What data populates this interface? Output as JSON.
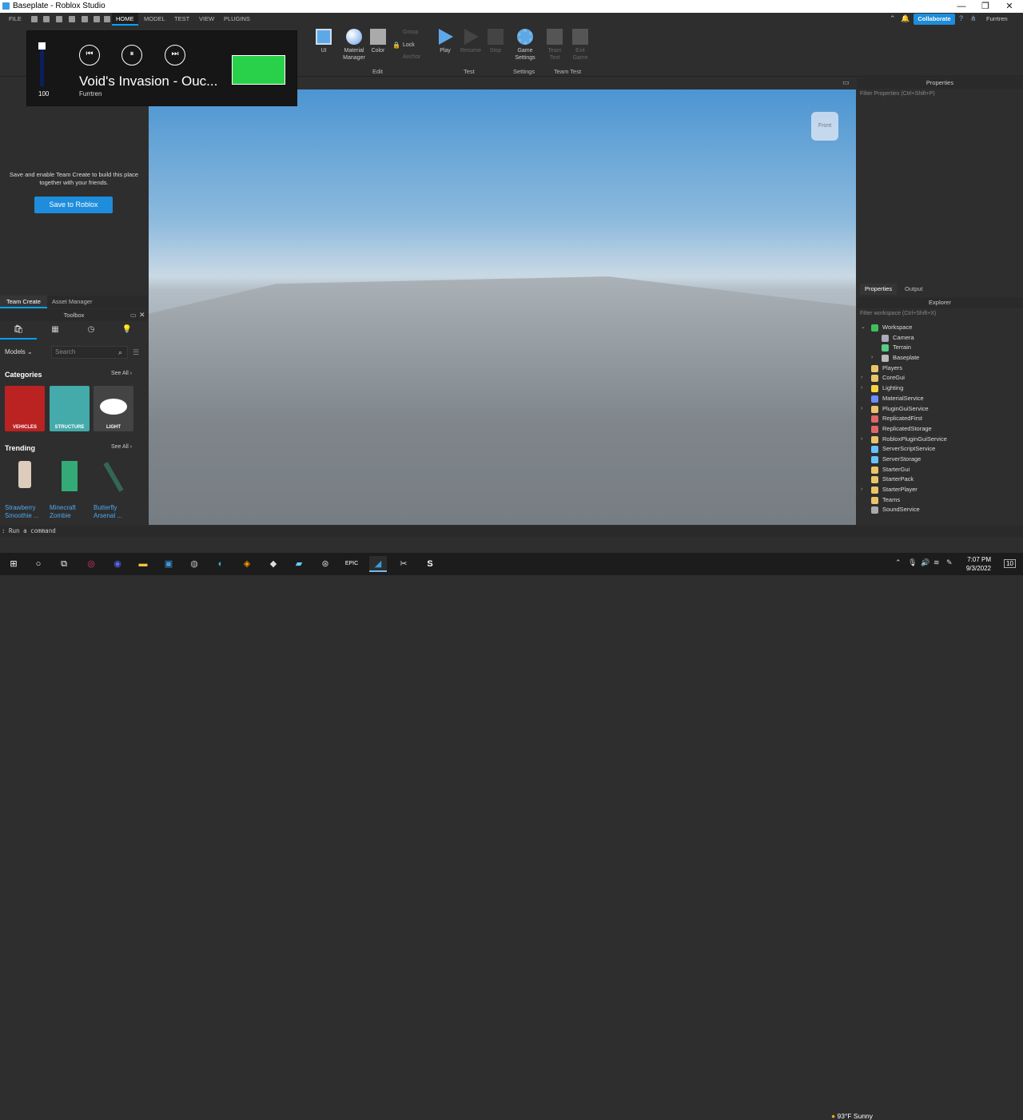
{
  "window": {
    "title": "Baseplate - Roblox Studio",
    "min": "—",
    "max": "❐",
    "close": "✕"
  },
  "menu": {
    "file": "FILE",
    "tabs": [
      "HOME",
      "MODEL",
      "TEST",
      "VIEW",
      "PLUGINS"
    ],
    "collaborate": "Collaborate",
    "user": "Furrtren"
  },
  "ribbon": {
    "ui": "UI",
    "material_manager": "Material Manager",
    "color": "Color",
    "group": "Group",
    "lock": "Lock",
    "anchor": "Anchor",
    "play": "Play",
    "resume": "Resume",
    "stop": "Stop",
    "game_settings": "Game Settings",
    "team_test": "Team Test",
    "exit_game": "Exit Game",
    "groups": {
      "edit": "Edit",
      "test": "Test",
      "settings": "Settings",
      "team_test": "Team Test"
    }
  },
  "media": {
    "song": "Void's Invasion - Ouc...",
    "artist": "Furrtren",
    "volume": "100",
    "prev": "⏮",
    "pause": "⏸",
    "next": "⏭"
  },
  "team_create": {
    "message": "Save and enable Team Create to build this place together with your friends.",
    "save_button": "Save to Roblox"
  },
  "left_tabs": [
    "Team Create",
    "Asset Manager"
  ],
  "toolbox": {
    "title": "Toolbox",
    "models": "Models",
    "search_placeholder": "Search",
    "categories_title": "Categories",
    "see_all": "See All ›",
    "categories": [
      "VEHICLES",
      "STRUCTURE",
      "LIGHT"
    ],
    "trending_title": "Trending",
    "trending": [
      [
        "Strawberry",
        "Smoothie ..."
      ],
      [
        "Minecraft",
        "Zombie"
      ],
      [
        "Butterfly",
        "Arsenal ..."
      ]
    ]
  },
  "viewport": {
    "view_cube_label": "Front"
  },
  "properties": {
    "title": "Properties",
    "filter": "Filter Properties (Ctrl+Shift+P)"
  },
  "right_tabs": [
    "Properties",
    "Output"
  ],
  "explorer": {
    "title": "Explorer",
    "filter": "Filter workspace (Ctrl+Shift+X)",
    "items": [
      {
        "name": "Workspace",
        "level": 0,
        "exp": "⌄",
        "color": "#3fbf5a"
      },
      {
        "name": "Camera",
        "level": 1,
        "exp": "",
        "color": "#aab"
      },
      {
        "name": "Terrain",
        "level": 1,
        "exp": "",
        "color": "#5c8"
      },
      {
        "name": "Baseplate",
        "level": 1,
        "exp": "›",
        "color": "#bbb"
      },
      {
        "name": "Players",
        "level": 0,
        "exp": "",
        "color": "#e9c46a"
      },
      {
        "name": "CoreGui",
        "level": 0,
        "exp": "›",
        "color": "#e9c46a"
      },
      {
        "name": "Lighting",
        "level": 0,
        "exp": "›",
        "color": "#f5d442"
      },
      {
        "name": "MaterialService",
        "level": 0,
        "exp": "",
        "color": "#6a8dff"
      },
      {
        "name": "PluginGuiService",
        "level": 0,
        "exp": "›",
        "color": "#e9c46a"
      },
      {
        "name": "ReplicatedFirst",
        "level": 0,
        "exp": "",
        "color": "#e06666"
      },
      {
        "name": "ReplicatedStorage",
        "level": 0,
        "exp": "",
        "color": "#e06666"
      },
      {
        "name": "RobloxPluginGuiService",
        "level": 0,
        "exp": "›",
        "color": "#e9c46a"
      },
      {
        "name": "ServerScriptService",
        "level": 0,
        "exp": "",
        "color": "#66c2ff"
      },
      {
        "name": "ServerStorage",
        "level": 0,
        "exp": "",
        "color": "#66c2ff"
      },
      {
        "name": "StarterGui",
        "level": 0,
        "exp": "",
        "color": "#e9c46a"
      },
      {
        "name": "StarterPack",
        "level": 0,
        "exp": "",
        "color": "#e9c46a"
      },
      {
        "name": "StarterPlayer",
        "level": 0,
        "exp": "›",
        "color": "#e9c46a"
      },
      {
        "name": "Teams",
        "level": 0,
        "exp": "",
        "color": "#e9c46a"
      },
      {
        "name": "SoundService",
        "level": 0,
        "exp": "",
        "color": "#aaa"
      }
    ]
  },
  "command_bar": {
    "placeholder": "Run a command"
  },
  "taskbar": {
    "weather": "93°F  Sunny",
    "time": "7:07 PM",
    "date": "9/3/2022",
    "notifications": "10"
  }
}
